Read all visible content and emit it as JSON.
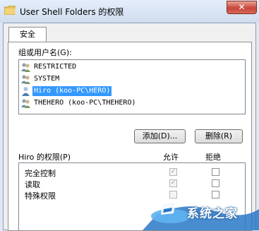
{
  "window": {
    "title": "User Shell Folders 的权限",
    "close_glyph": "✕"
  },
  "tabs": [
    {
      "label": "安全"
    }
  ],
  "groups": {
    "label": "组或用户名(G):",
    "items": [
      {
        "label": "RESTRICTED",
        "icon": "user-group-icon",
        "selected": false
      },
      {
        "label": "SYSTEM",
        "icon": "user-group-icon",
        "selected": false
      },
      {
        "label": "Hiro (koo-PC\\HERO)",
        "icon": "user-icon",
        "selected": true
      },
      {
        "label": "THEHERO (koo-PC\\THEHERO)",
        "icon": "user-group-icon",
        "selected": false
      }
    ]
  },
  "buttons": {
    "add": "添加(D)...",
    "remove": "删除(R)"
  },
  "permissions": {
    "label": "Hiro 的权限(P)",
    "allow_label": "允许",
    "deny_label": "拒绝",
    "rows": [
      {
        "name": "完全控制",
        "allow": true,
        "deny": false
      },
      {
        "name": "读取",
        "allow": true,
        "deny": false
      },
      {
        "name": "特殊权限",
        "allow": false,
        "deny": false
      }
    ]
  },
  "watermark": {
    "text": "系统之家"
  }
}
